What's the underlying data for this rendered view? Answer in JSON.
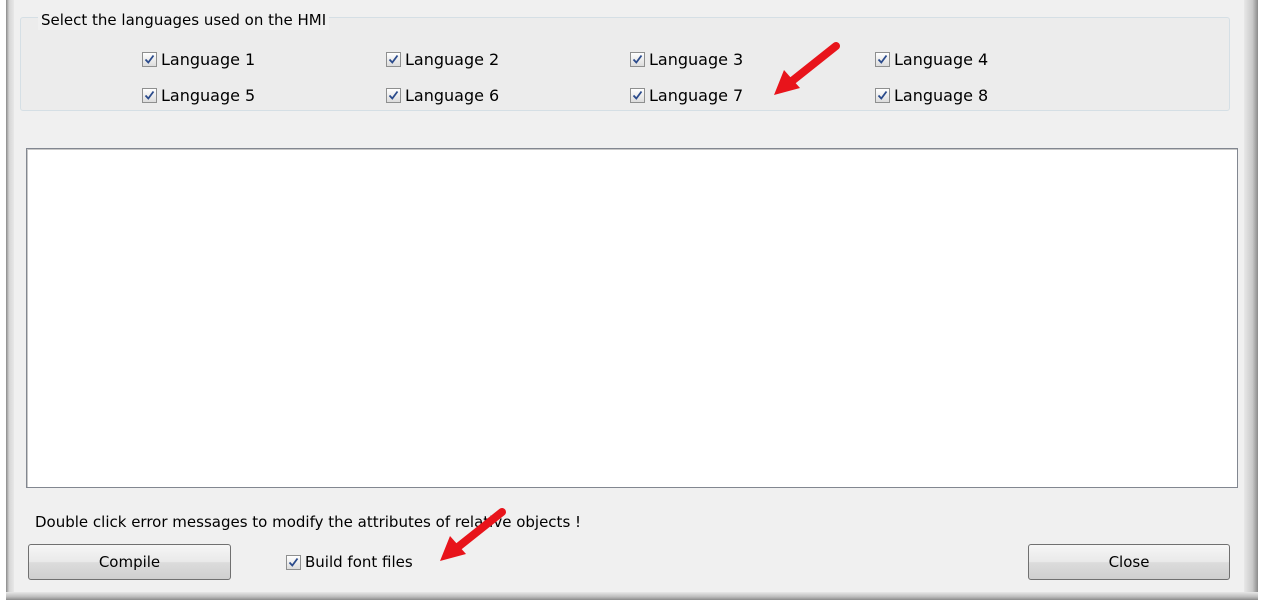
{
  "languages_group": {
    "title": "Select the languages used on the HMI",
    "items": [
      {
        "label": "Language 1",
        "checked": true
      },
      {
        "label": "Language 2",
        "checked": true
      },
      {
        "label": "Language 3",
        "checked": true
      },
      {
        "label": "Language 4",
        "checked": true
      },
      {
        "label": "Language 5",
        "checked": true
      },
      {
        "label": "Language 6",
        "checked": true
      },
      {
        "label": "Language 7",
        "checked": true
      },
      {
        "label": "Language 8",
        "checked": true
      }
    ]
  },
  "output": {
    "messages": []
  },
  "hint_text": "Double click  error messages  to modify the attributes of  relative objects !",
  "buttons": {
    "compile": "Compile",
    "close": "Close"
  },
  "build_font": {
    "label": "Build font files",
    "checked": true
  },
  "colors": {
    "annotation_arrow": "#e8141b",
    "checkmark": "#2b4b8c"
  }
}
